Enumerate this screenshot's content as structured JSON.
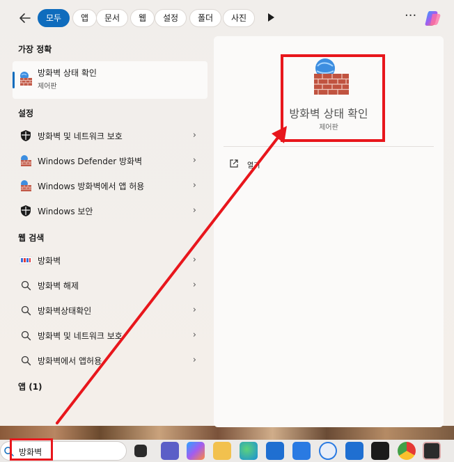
{
  "filters": {
    "back_icon": "back-arrow-icon",
    "chips": [
      "모두",
      "앱",
      "문서",
      "웹",
      "설정",
      "폴더",
      "사진"
    ],
    "more_icon": "more-dots-icon",
    "more_label": "···"
  },
  "best_match": {
    "heading": "가장 정확",
    "title": "방화벽 상태 확인",
    "subtitle": "제어판"
  },
  "settings": {
    "heading": "설정",
    "items": [
      {
        "label": "방화벽 및 네트워크 보호",
        "icon": "shield-icon"
      },
      {
        "label": "Windows Defender 방화벽",
        "icon": "firewall-icon"
      },
      {
        "label": "Windows 방화벽에서 앱 허용",
        "icon": "firewall-icon"
      },
      {
        "label": "Windows 보안",
        "icon": "shield-icon"
      }
    ]
  },
  "web": {
    "heading": "웹 검색",
    "items": [
      {
        "label": "방화벽",
        "icon": "web-thumb-icon"
      },
      {
        "label": "방화벽 해제",
        "icon": "search-icon"
      },
      {
        "label": "방화벽상태확인",
        "icon": "search-icon"
      },
      {
        "label": "방화벽 및 네트워크 보호",
        "icon": "search-icon"
      },
      {
        "label": "방화벽에서 앱허용",
        "icon": "search-icon"
      }
    ]
  },
  "apps": {
    "heading": "앱 (1)"
  },
  "preview": {
    "title": "방화벽 상태 확인",
    "subtitle": "제어판",
    "open_label": "열기"
  },
  "chevron": "›",
  "search": {
    "value": "방화벽"
  },
  "colors": {
    "accent": "#0f6cbd",
    "highlight": "#e8161c"
  }
}
